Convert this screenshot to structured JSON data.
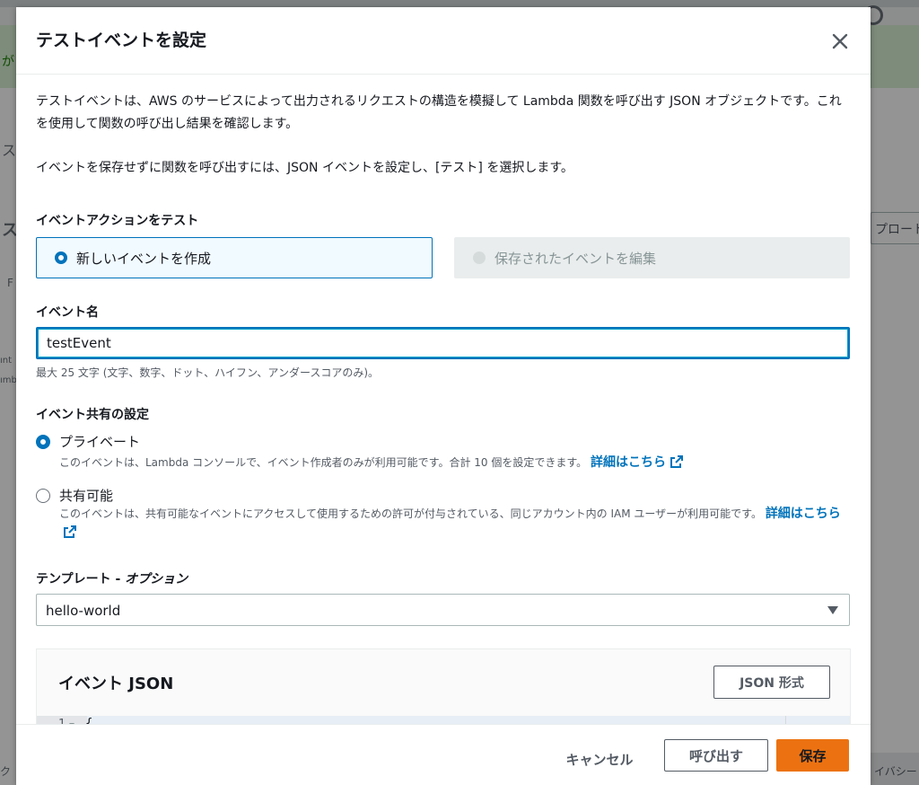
{
  "background": {
    "fragments": [
      "が",
      "ス",
      "ス",
      "F",
      "ınt",
      "ımbo",
      "ク"
    ],
    "right_button": "プロート",
    "bottom_right": "イバシー"
  },
  "modal": {
    "title": "テストイベントを設定",
    "description": "テストイベントは、AWS のサービスによって出力されるリクエストの構造を模擬して Lambda 関数を呼び出す JSON オブジェクトです。これを使用して関数の呼び出し結果を確認します。",
    "description2": "イベントを保存せずに関数を呼び出すには、JSON イベントを設定し、[テスト] を選択します。",
    "event_action": {
      "label": "イベントアクションをテスト",
      "new_event": "新しいイベントを作成",
      "edit_saved": "保存されたイベントを編集"
    },
    "event_name": {
      "label": "イベント名",
      "value": "testEvent",
      "hint": "最大 25 文字 (文字、数字、ドット、ハイフン、アンダースコアのみ)。"
    },
    "sharing": {
      "label": "イベント共有の設定",
      "private_label": "プライベート",
      "private_desc": "このイベントは、Lambda コンソールで、イベント作成者のみが利用可能です。合計 10 個を設定できます。",
      "shareable_label": "共有可能",
      "shareable_desc": "このイベントは、共有可能なイベントにアクセスして使用するための許可が付与されている、同じアカウント内の IAM ユーザーが利用可能です。",
      "learn_more": "詳細はこちら"
    },
    "template": {
      "label_main": "テンプレート - ",
      "label_optional": "オプション",
      "value": "hello-world"
    },
    "event_json": {
      "title": "イベント JSON",
      "format_button": "JSON 形式",
      "line_number": "1",
      "code_line": "{"
    },
    "footer": {
      "cancel": "キャンセル",
      "invoke": "呼び出す",
      "save": "保存"
    }
  },
  "colors": {
    "accent": "#0073bb",
    "primary": "#ec7211"
  }
}
